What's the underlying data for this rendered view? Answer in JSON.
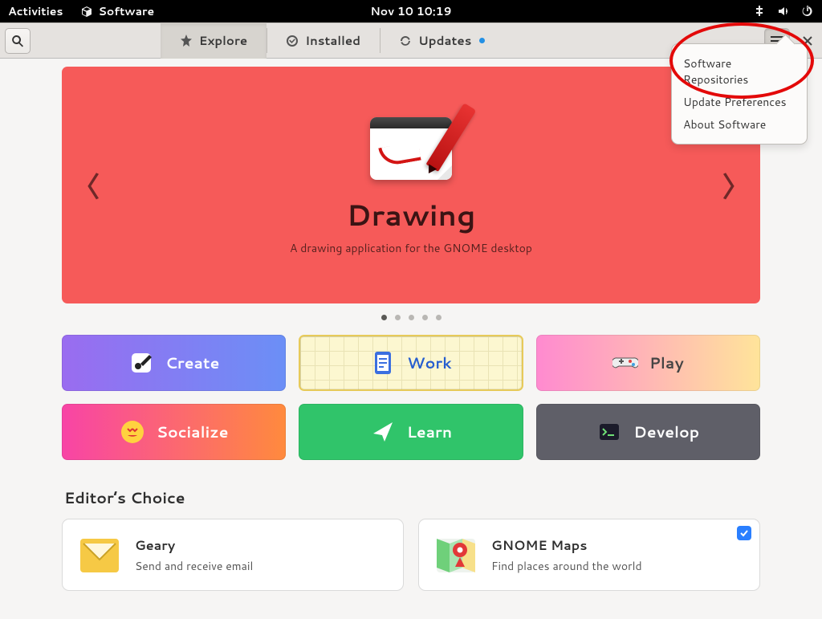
{
  "panel": {
    "activities": "Activities",
    "app_name": "Software",
    "datetime": "Nov 10  10:19"
  },
  "header": {
    "tabs": {
      "explore": "Explore",
      "installed": "Installed",
      "updates": "Updates"
    }
  },
  "menu": {
    "repos": "Software Repositories",
    "update_prefs": "Update Preferences",
    "about": "About Software"
  },
  "banner": {
    "title": "Drawing",
    "desc": "A drawing application for the GNOME desktop"
  },
  "categories": {
    "create": "Create",
    "work": "Work",
    "play": "Play",
    "socialize": "Socialize",
    "learn": "Learn",
    "develop": "Develop"
  },
  "editors_choice": {
    "heading": "Editor’s Choice",
    "geary": {
      "name": "Geary",
      "desc": "Send and receive email"
    },
    "maps": {
      "name": "GNOME Maps",
      "desc": "Find places around the world"
    }
  }
}
